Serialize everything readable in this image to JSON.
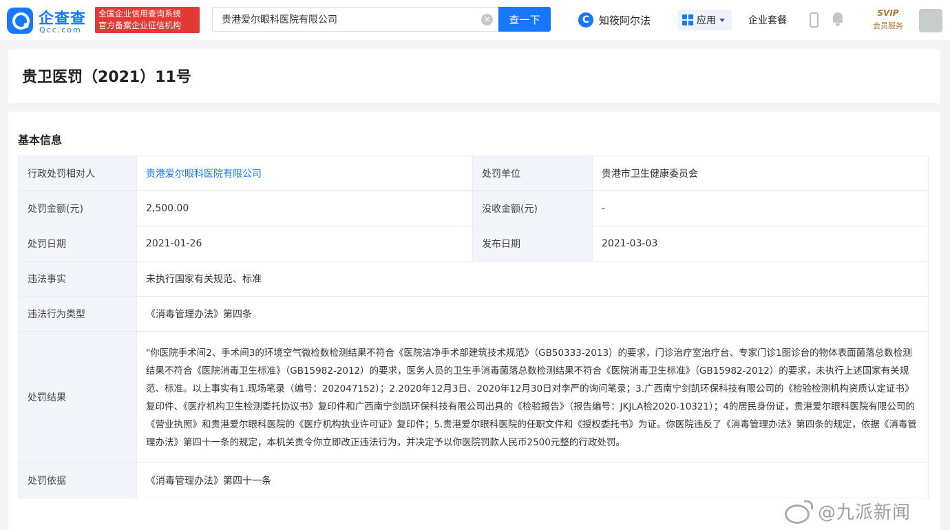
{
  "header": {
    "logo_text": "企查查",
    "logo_sub": "Qcc.com",
    "badge_line1": "全国企业信用查询系统",
    "badge_line2": "官方备案企业征信机构",
    "search_value": "贵港爱尔眼科医院有限公司",
    "search_button": "查一下",
    "zhi_label": "知筱阿尔法",
    "app_label": "应用",
    "enterprise_label": "企业套餐",
    "svip_top": "SVIP",
    "svip_bottom": "会员服务"
  },
  "page": {
    "title": "贵卫医罚（2021）11号"
  },
  "basic_info": {
    "section_title": "基本信息",
    "rows": {
      "target_label": "行政处罚相对人",
      "target_value": "贵港爱尔眼科医院有限公司",
      "unit_label": "处罚单位",
      "unit_value": "贵港市卫生健康委员会",
      "amount_label": "处罚金额(元)",
      "amount_value": "2,500.00",
      "confiscate_label": "没收金额(元)",
      "confiscate_value": "-",
      "date_label": "处罚日期",
      "date_value": "2021-01-26",
      "publish_label": "发布日期",
      "publish_value": "2021-03-03",
      "fact_label": "违法事实",
      "fact_value": "未执行国家有关规范、标准",
      "type_label": "违法行为类型",
      "type_value": "《消毒管理办法》第四条",
      "result_label": "处罚结果",
      "result_value": "\"你医院手术间2、手术间3的环境空气微检数检测结果不符合《医院洁净手术部建筑技术规范》（GB50333-2013）的要求，门诊治疗室治疗台、专家门诊1图诊台的物体表面菌落总数检测结果不符合《医院消毒卫生标准》（GB15982-2012）的要求，医务人员的卫生手消毒菌落总数检测结果不符合《医院消毒卫生标准》（GB15982-2012）的要求，未执行上述国家有关规范、标准。以上事实有1.现场笔录（编号：202047152）；2.2020年12月3日、2020年12月30日对李严的询问笔录；3.广西南宁剑凯环保科技有限公司的《检验检测机构资质认定证书》复印件、《医疗机构卫生检测委托协议书》复印件和广西南宁剑凯环保科技有限公司出具的《检验报告》（报告编号：JKJLA检2020-10321）；4的居民身份证，贵港爱尔眼科医院有限公司的《营业执照》和贵港爱尔眼科医院的《医疗机构执业许可证》复印件；5.贵港爱尔眼科医院的任职文件和《授权委托书》为证。你医院违反了《消毒管理办法》第四条的规定，依据《消毒管理办法》第四十一条的规定，本机关责令你立即改正违法行为，并决定予以你医院罚款人民币2500元整的行政处罚。",
      "basis_label": "处罚依据",
      "basis_value": "《消毒管理办法》第四十一条"
    }
  },
  "watermark": {
    "text": "@九派新闻"
  }
}
